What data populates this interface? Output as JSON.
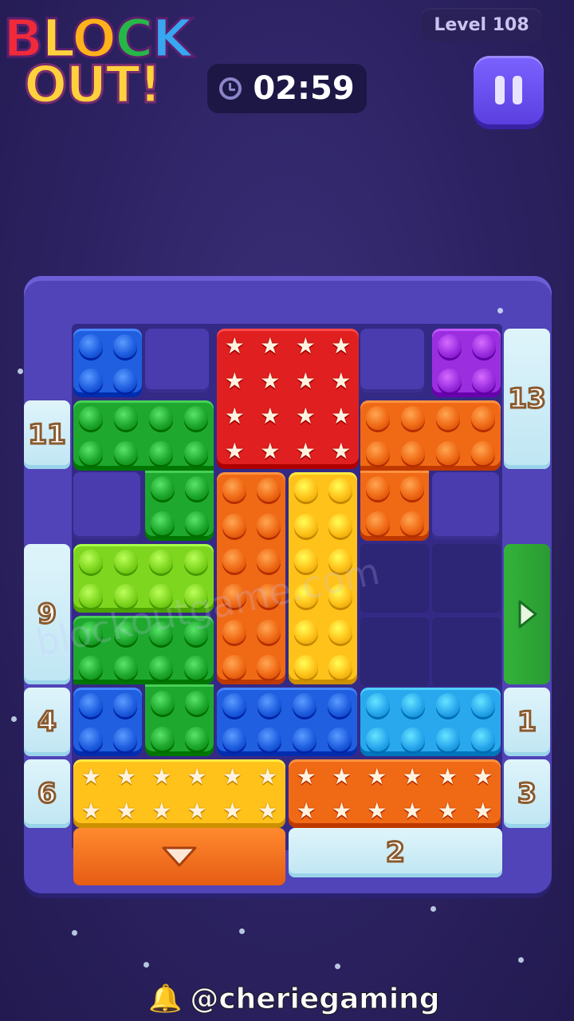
{
  "header": {
    "logo_line1": "BLOCK",
    "logo_line2": "OUT!",
    "level_label": "Level 108",
    "timer": "02:59",
    "pause_icon": "pause-icon"
  },
  "board": {
    "gates": [
      {
        "id": "gate-11",
        "label": "11"
      },
      {
        "id": "gate-13",
        "label": "13"
      },
      {
        "id": "gate-9",
        "label": "9"
      },
      {
        "id": "gate-4",
        "label": "4"
      },
      {
        "id": "gate-6",
        "label": "6"
      },
      {
        "id": "gate-1",
        "label": "1"
      },
      {
        "id": "gate-3",
        "label": "3"
      },
      {
        "id": "gate-2",
        "label": "2"
      }
    ],
    "exit_right_icon": "play-arrow-icon",
    "exit_bottom_icon": "down-arrow-icon",
    "colors": {
      "blue": "#1f5fe0",
      "purple": "#9b2fe0",
      "red": "#e02020",
      "orange": "#f06a16",
      "green": "#1fa82e",
      "lime": "#7fd61f",
      "yellow": "#ffc21a",
      "light_blue": "#2aa8ee"
    }
  },
  "watermark": "blockoutgame.com",
  "footer": {
    "bell_icon": "bell-icon",
    "handle": "@cheriegaming"
  }
}
